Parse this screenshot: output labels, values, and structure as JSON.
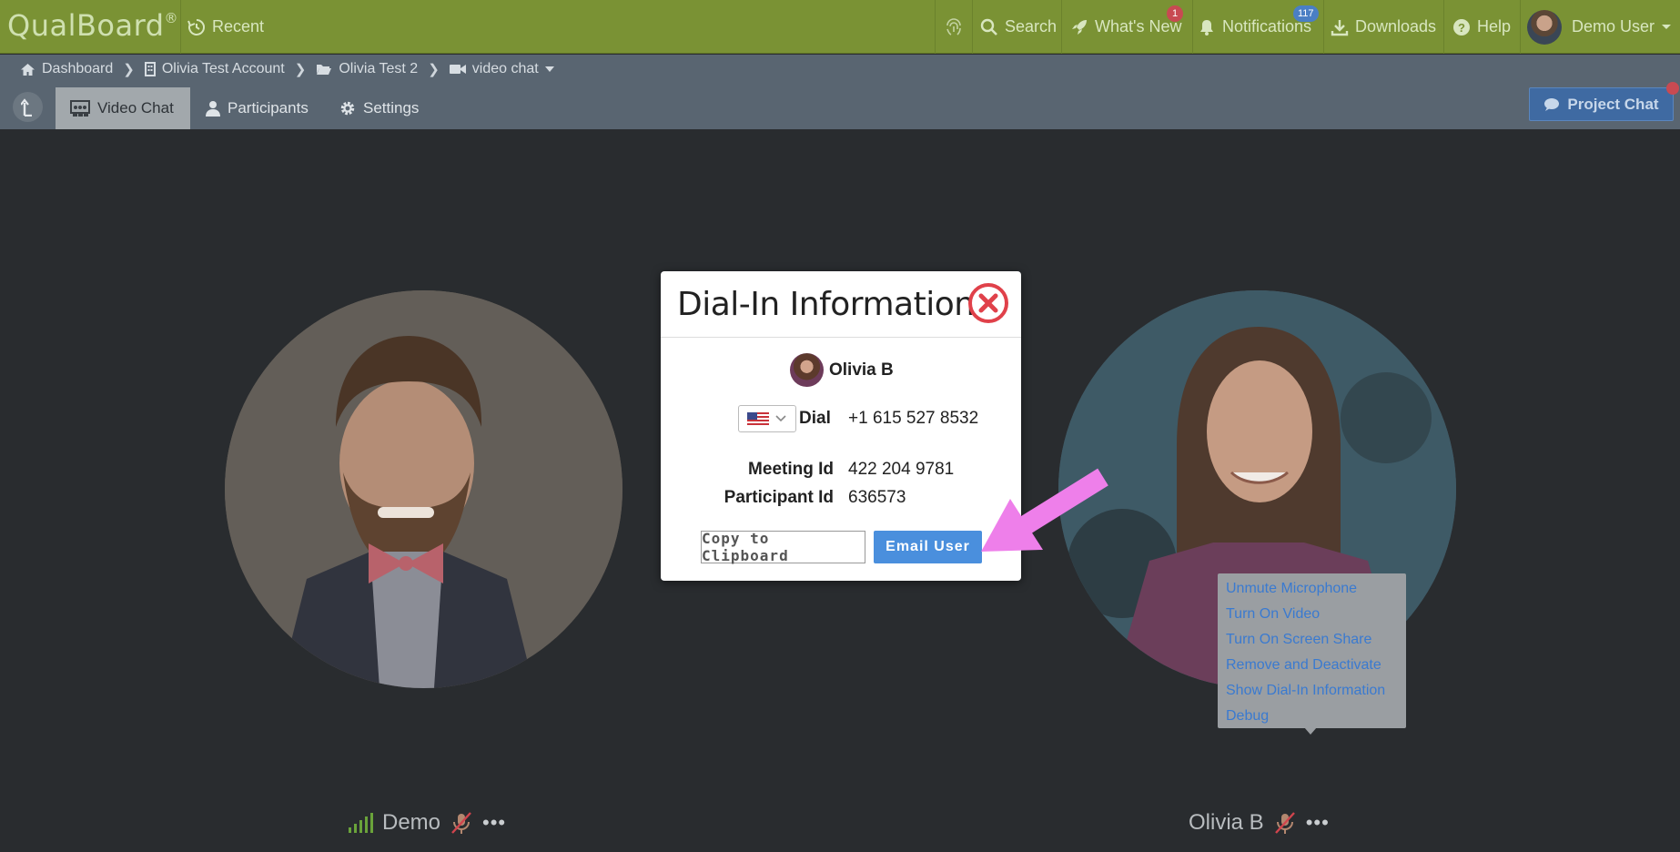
{
  "topbar": {
    "logo": "QualBoard",
    "logo_mark": "®",
    "recent": "Recent",
    "search": "Search",
    "whats_new": "What's New",
    "whats_new_badge": "1",
    "notifications": "Notifications",
    "notifications_badge": "117",
    "downloads": "Downloads",
    "help": "Help",
    "user": "Demo User"
  },
  "breadcrumb": {
    "items": [
      "Dashboard",
      "Olivia Test Account",
      "Olivia Test 2",
      "video chat"
    ]
  },
  "tabs": [
    "Video Chat",
    "Participants",
    "Settings"
  ],
  "project_chat": "Project Chat",
  "modal": {
    "title": "Dial-In Information",
    "participant_name": "Olivia B",
    "dial_label": "Dial",
    "dial_number": "+1 615 527 8532",
    "meeting_label": "Meeting Id",
    "meeting_id": "422 204 9781",
    "participant_label": "Participant Id",
    "participant_id": "636573",
    "copy_button": "Copy to Clipboard",
    "email_button": "Email User"
  },
  "participants": [
    {
      "name": "Demo"
    },
    {
      "name": "Olivia B"
    }
  ],
  "context_menu": {
    "items": [
      "Unmute Microphone",
      "Turn On Video",
      "Turn On Screen Share",
      "Remove and Deactivate",
      "Show Dial-In Information",
      "Debug"
    ]
  },
  "colors": {
    "topbar": "#7a9234",
    "accent_blue": "#4a8fdd",
    "close_red": "#e0414a",
    "arrow_pink": "#ee7fea"
  }
}
